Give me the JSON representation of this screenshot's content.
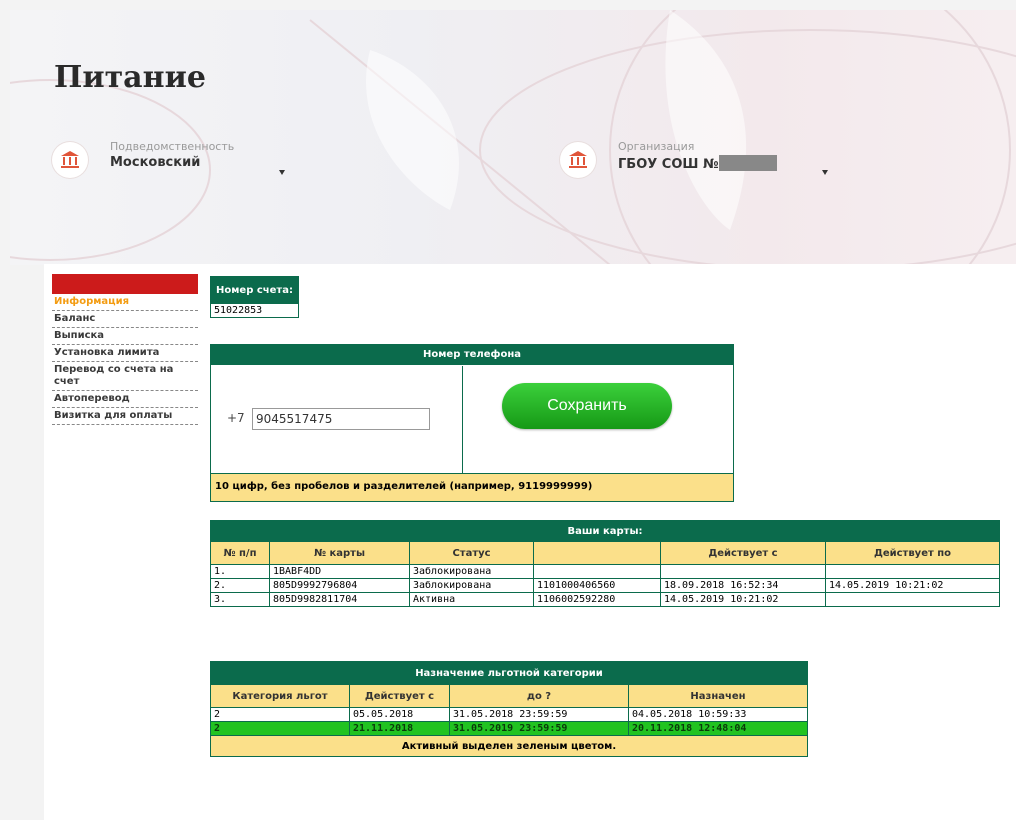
{
  "page": {
    "title": "Питание",
    "colors": {
      "accent_red": "#cc1b1b",
      "header_green": "#0b6b4c",
      "header_yellow": "#fbe08a",
      "active_green": "#21c321",
      "sidebar_active": "#f39c12"
    }
  },
  "selectors": {
    "subordination": {
      "caption": "Подведомственность",
      "value": "Московский",
      "icon": "bank-icon"
    },
    "organization": {
      "caption": "Организация",
      "value": "ГБОУ СОШ №",
      "icon": "bank-icon"
    }
  },
  "sidebar": {
    "items": [
      {
        "label": "Информация",
        "active": true
      },
      {
        "label": "Баланс"
      },
      {
        "label": "Выписка"
      },
      {
        "label": "Установка лимита"
      },
      {
        "label": "Перевод со счета на счет"
      },
      {
        "label": "Автоперевод"
      },
      {
        "label": "Визитка для оплаты"
      }
    ]
  },
  "account": {
    "header": "Номер счета:",
    "number": "51022853"
  },
  "phone": {
    "header": "Номер телефона",
    "prefix": "+7",
    "value": "9045517475",
    "save_label": "Сохранить",
    "hint": "10 цифр, без пробелов и разделителей (например, 9119999999)"
  },
  "cards": {
    "header": "Ваши карты:",
    "columns": [
      "№ п/п",
      "№ карты",
      "Статус",
      "",
      "Действует с",
      "Действует по"
    ],
    "rows": [
      [
        "1.",
        "1BABF4DD",
        "Заблокирована",
        "",
        "",
        ""
      ],
      [
        "2.",
        "805D9992796804",
        "Заблокирована",
        "1101000406560",
        "18.09.2018 16:52:34",
        "14.05.2019 10:21:02"
      ],
      [
        "3.",
        "805D9982811704",
        "Активна",
        "1106002592280",
        "14.05.2019 10:21:02",
        ""
      ]
    ]
  },
  "benefit": {
    "header": "Назначение льготной категории",
    "columns": [
      "Категория льгот",
      "Действует с",
      "до ?",
      "Назначен"
    ],
    "rows": [
      [
        "2",
        "05.05.2018",
        "31.05.2018 23:59:59",
        "04.05.2018 10:59:33"
      ],
      [
        "2",
        "21.11.2018",
        "31.05.2019 23:59:59",
        "20.11.2018 12:48:04"
      ]
    ],
    "note": "Активный выделен зеленым цветом."
  }
}
